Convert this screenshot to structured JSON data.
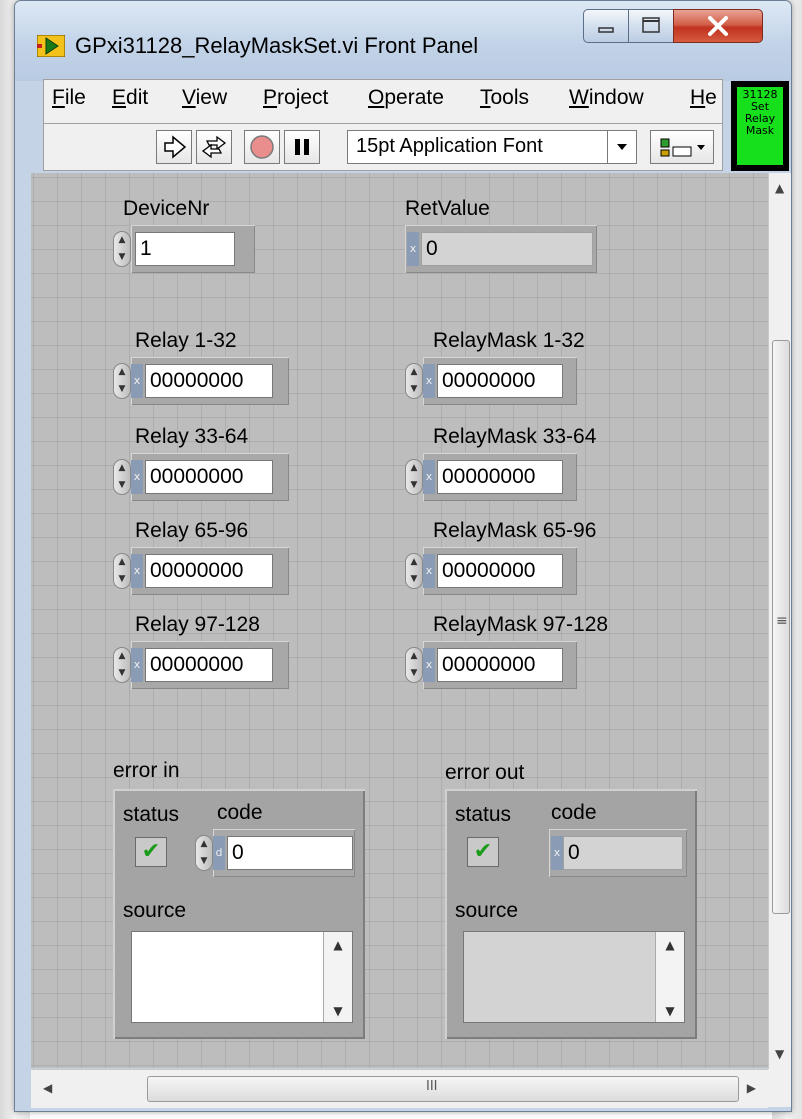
{
  "window": {
    "title": "GPxi31128_RelayMaskSet.vi Front Panel"
  },
  "menubar": {
    "items": [
      "File",
      "Edit",
      "View",
      "Project",
      "Operate",
      "Tools",
      "Window",
      "He"
    ]
  },
  "toolbar": {
    "buttons": [
      "run-arrow-icon",
      "run-continuously-icon",
      "abort-icon",
      "pause-icon"
    ],
    "font": "15pt Application Font",
    "align": "align-objects-icon"
  },
  "vi_icon": {
    "text": "31128\nSet\nRelay\nMask",
    "color": "#16e01b"
  },
  "panel": {
    "device_nr": {
      "label": "DeviceNr",
      "value": "1"
    },
    "ret_value": {
      "label": "RetValue",
      "value": "0",
      "radix": "x"
    },
    "relays": [
      {
        "label": "Relay 1-32",
        "value": "00000000",
        "radix": "x"
      },
      {
        "label": "Relay 33-64",
        "value": "00000000",
        "radix": "x"
      },
      {
        "label": "Relay 65-96",
        "value": "00000000",
        "radix": "x"
      },
      {
        "label": "Relay 97-128",
        "value": "00000000",
        "radix": "x"
      }
    ],
    "masks": [
      {
        "label": "RelayMask 1-32",
        "value": "00000000",
        "radix": "x"
      },
      {
        "label": "RelayMask 33-64",
        "value": "00000000",
        "radix": "x"
      },
      {
        "label": "RelayMask 65-96",
        "value": "00000000",
        "radix": "x"
      },
      {
        "label": "RelayMask 97-128",
        "value": "00000000",
        "radix": "x"
      }
    ],
    "error_in": {
      "label": "error in",
      "status_label": "status",
      "code_label": "code",
      "code_value": "0",
      "code_radix": "d",
      "source_label": "source",
      "source_value": "",
      "status": true
    },
    "error_out": {
      "label": "error out",
      "status_label": "status",
      "code_label": "code",
      "code_value": "0",
      "code_radix": "x",
      "source_label": "source",
      "source_value": "",
      "status": true
    }
  },
  "scrollbars": {
    "vertical_grip": "≡",
    "horizontal_grip": "III"
  },
  "colors": {
    "panel_bg": "#bdbdbd",
    "titlebar": "#c4d3e6",
    "close": "#c0321f",
    "status_ok": "#1a9b1a"
  }
}
